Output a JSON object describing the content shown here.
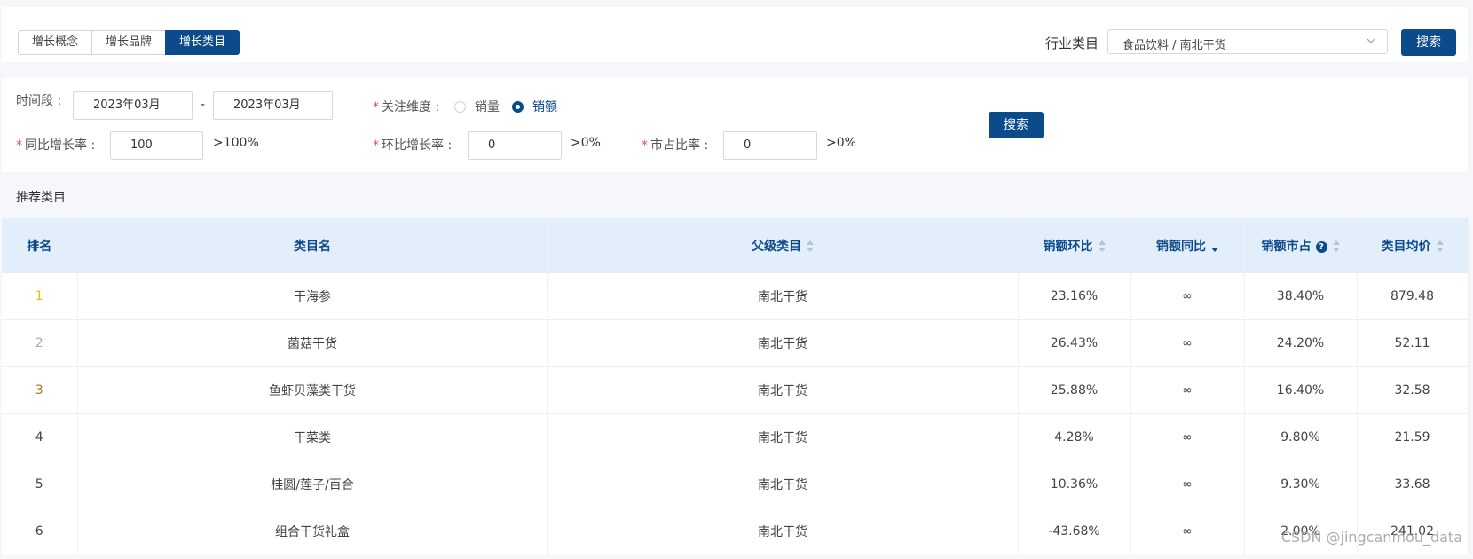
{
  "tabs": [
    {
      "label": "增长概念",
      "active": false
    },
    {
      "label": "增长品牌",
      "active": false
    },
    {
      "label": "增长类目",
      "active": true
    }
  ],
  "industry": {
    "label": "行业类目",
    "value": "食品饮料 / 南北干货",
    "search_label": "搜索"
  },
  "filters": {
    "period_label": "时间段 :",
    "period_start": "2023年03月",
    "period_end": "2023年03月",
    "period_sep": "-",
    "dimension_label": "关注维度 :",
    "dimension_options": [
      {
        "label": "销量",
        "checked": false
      },
      {
        "label": "销额",
        "checked": true
      }
    ],
    "yoy_label": "同比增长率 :",
    "yoy_value": "100",
    "yoy_suffix": ">100%",
    "mom_label": "环比增长率 :",
    "mom_value": "0",
    "mom_suffix": ">0%",
    "share_label": "市占比率 :",
    "share_value": "0",
    "share_suffix": ">0%",
    "required_mark": "*",
    "search_label": "搜索"
  },
  "section_title": "推荐类目",
  "table": {
    "columns": [
      "排名",
      "类目名",
      "父级类目",
      "销额环比",
      "销额同比",
      "销额市占",
      "类目均价"
    ],
    "help_glyph": "?",
    "rows": [
      {
        "rank": "1",
        "rank_color": "#f5b800",
        "name": "干海参",
        "parent": "南北干货",
        "mom": "23.16%",
        "yoy": "∞",
        "share": "38.40%",
        "price": "879.48"
      },
      {
        "rank": "2",
        "rank_color": "#a8adb3",
        "name": "菌菇干货",
        "parent": "南北干货",
        "mom": "26.43%",
        "yoy": "∞",
        "share": "24.20%",
        "price": "52.11"
      },
      {
        "rank": "3",
        "rank_color": "#a9752a",
        "name": "鱼虾贝藻类干货",
        "parent": "南北干货",
        "mom": "25.88%",
        "yoy": "∞",
        "share": "16.40%",
        "price": "32.58"
      },
      {
        "rank": "4",
        "rank_color": "#444444",
        "name": "干菜类",
        "parent": "南北干货",
        "mom": "4.28%",
        "yoy": "∞",
        "share": "9.80%",
        "price": "21.59"
      },
      {
        "rank": "5",
        "rank_color": "#444444",
        "name": "桂圆/莲子/百合",
        "parent": "南北干货",
        "mom": "10.36%",
        "yoy": "∞",
        "share": "9.30%",
        "price": "33.68"
      },
      {
        "rank": "6",
        "rank_color": "#444444",
        "name": "组合干货礼盒",
        "parent": "南北干货",
        "mom": "-43.68%",
        "yoy": "∞",
        "share": "2.00%",
        "price": "241.02"
      }
    ]
  },
  "watermark": "CSDN @jingcanmou_data",
  "colors": {
    "primary": "#0b4a8b",
    "header_bg": "#e3eefb",
    "required": "#e0524a"
  }
}
